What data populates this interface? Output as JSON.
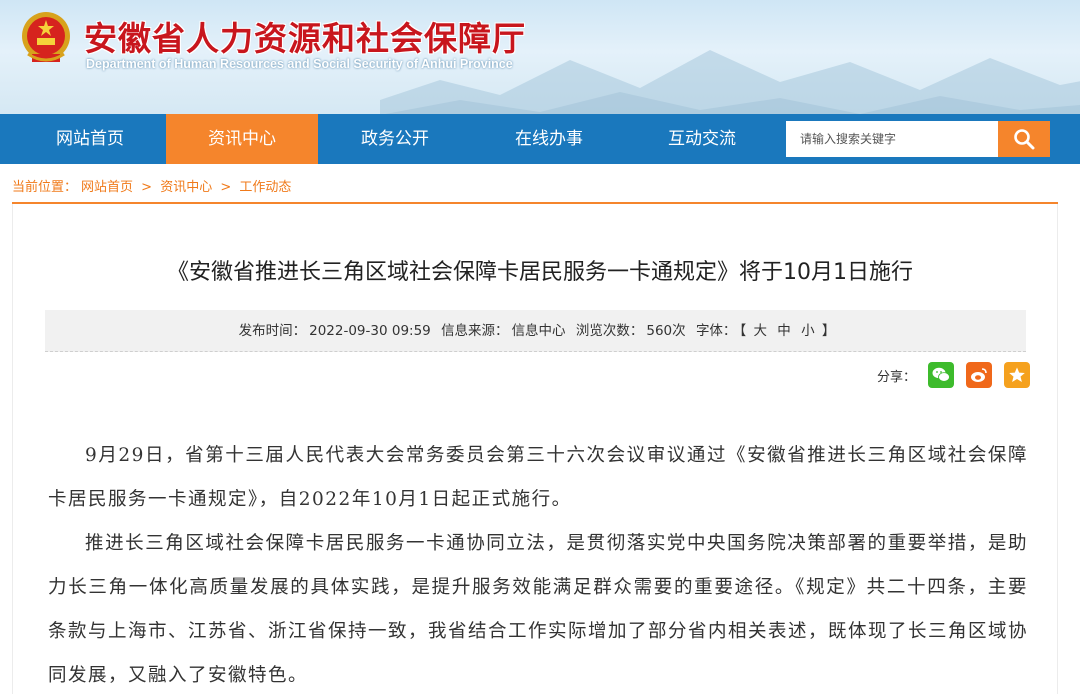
{
  "header": {
    "title": "安徽省人力资源和社会保障厅",
    "subtitle": "Department of Human Resources and Social Security of Anhui Province",
    "emblem_icon": "national-emblem-icon"
  },
  "nav": {
    "items": [
      {
        "label": "网站首页",
        "active": false
      },
      {
        "label": "资讯中心",
        "active": true
      },
      {
        "label": "政务公开",
        "active": false
      },
      {
        "label": "在线办事",
        "active": false
      },
      {
        "label": "互动交流",
        "active": false
      }
    ],
    "search": {
      "placeholder": "请输入搜索关键字",
      "icon": "search-icon"
    }
  },
  "breadcrumb": {
    "prefix": "当前位置：",
    "items": [
      "网站首页",
      "资讯中心",
      "工作动态"
    ],
    "separator": ">"
  },
  "article": {
    "title": "《安徽省推进长三角区域社会保障卡居民服务一卡通规定》将于10月1日施行",
    "meta": {
      "publish_label": "发布时间：",
      "publish_time": "2022-09-30 09:59",
      "source_label": "信息来源：",
      "source": "信息中心",
      "views_label": "浏览次数：",
      "views": "560次",
      "font_label": "字体：",
      "font_open": "【",
      "font_large": "大",
      "font_medium": "中",
      "font_small": "小",
      "font_close": "】"
    },
    "share": {
      "label": "分享：",
      "icons": [
        "wechat-icon",
        "weibo-icon",
        "favorite-icon"
      ]
    },
    "paragraphs": [
      "9月29日，省第十三届人民代表大会常务委员会第三十六次会议审议通过《安徽省推进长三角区域社会保障卡居民服务一卡通规定》，自2022年10月1日起正式施行。",
      "推进长三角区域社会保障卡居民服务一卡通协同立法，是贯彻落实党中央国务院决策部署的重要举措，是助力长三角一体化高质量发展的具体实践，是提升服务效能满足群众需要的重要途径。《规定》共二十四条，主要条款与上海市、江苏省、浙江省保持一致，我省结合工作实际增加了部分省内相关表述，既体现了长三角区域协同发展，又融入了安徽特色。"
    ]
  },
  "colors": {
    "brand_blue": "#1a78bd",
    "accent_orange": "#f5852c",
    "title_red": "#c8161d",
    "wechat_green": "#3dbb2c",
    "weibo_orange": "#f0681a",
    "fav_orange": "#f5a11e"
  }
}
